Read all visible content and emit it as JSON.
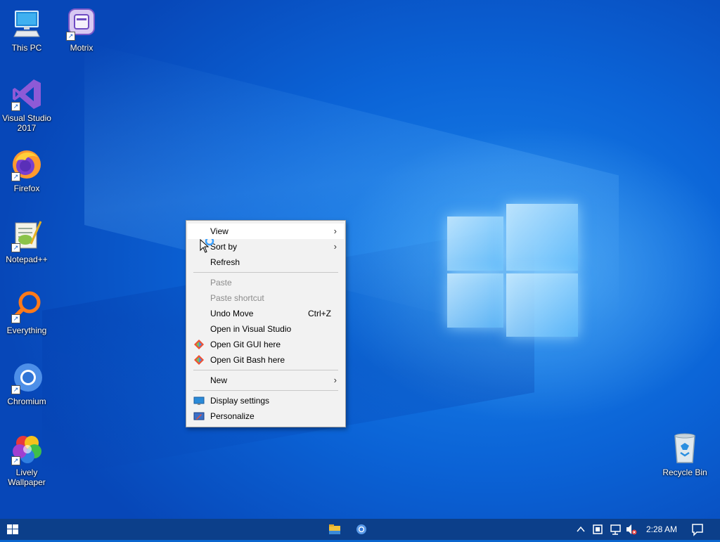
{
  "desktop": {
    "icons": [
      {
        "label": "This PC"
      },
      {
        "label": "Motrix"
      },
      {
        "label": "Visual Studio 2017"
      },
      {
        "label": "Firefox"
      },
      {
        "label": "Notepad++"
      },
      {
        "label": "Everything"
      },
      {
        "label": "Chromium"
      },
      {
        "label": "Lively Wallpaper"
      },
      {
        "label": "Recycle Bin"
      }
    ]
  },
  "context_menu": {
    "items": [
      {
        "label": "View",
        "submenu": true,
        "state": "highlighted"
      },
      {
        "label": "Sort by",
        "submenu": true
      },
      {
        "label": "Refresh"
      },
      {
        "label": "Paste",
        "state": "disabled"
      },
      {
        "label": "Paste shortcut",
        "state": "disabled"
      },
      {
        "label": "Undo Move",
        "shortcut": "Ctrl+Z"
      },
      {
        "label": "Open in Visual Studio"
      },
      {
        "label": "Open Git GUI here",
        "icon": "git-icon"
      },
      {
        "label": "Open Git Bash here",
        "icon": "git-icon"
      },
      {
        "label": "New",
        "submenu": true
      },
      {
        "label": "Display settings",
        "icon": "display-icon"
      },
      {
        "label": "Personalize",
        "icon": "personalize-icon"
      }
    ],
    "submenu_arrow": "›"
  },
  "taskbar": {
    "clock": "2:28 AM",
    "color": "#0c3f8a"
  }
}
